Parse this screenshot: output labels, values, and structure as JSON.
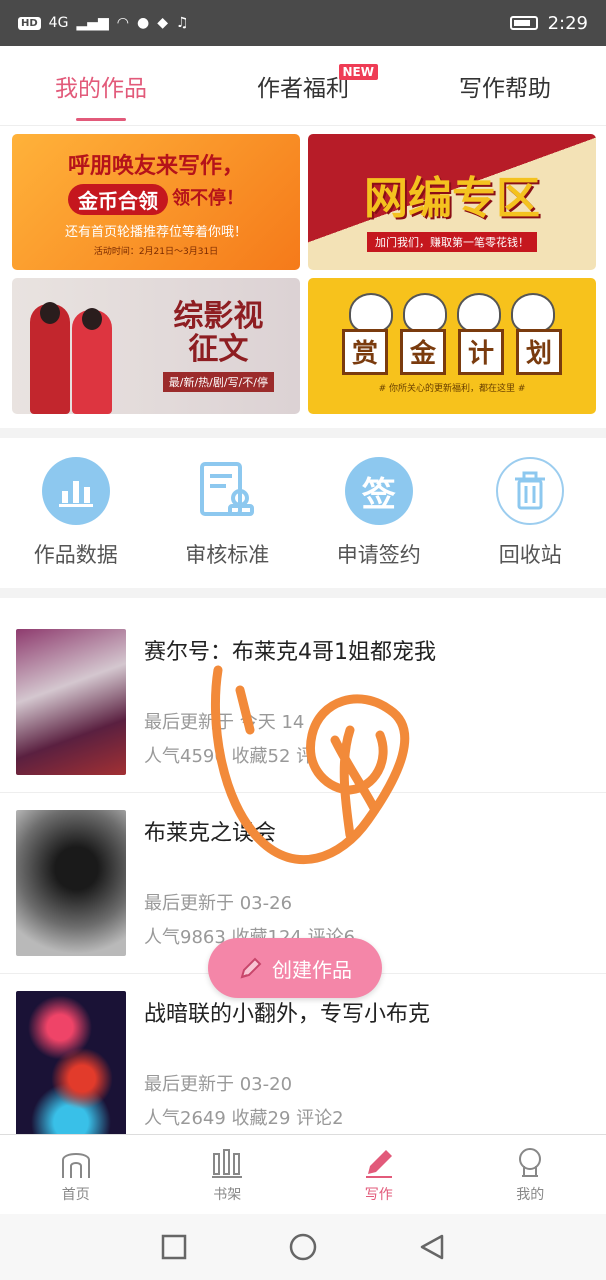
{
  "status_bar": {
    "chips": [
      "HD",
      "4G"
    ],
    "time": "2:29"
  },
  "tabs": [
    {
      "label": "我的作品"
    },
    {
      "label": "作者福利",
      "badge": "NEW"
    },
    {
      "label": "写作帮助"
    }
  ],
  "banners": {
    "b1": {
      "line1": "呼朋唤友来写作，",
      "line2": "金币合领",
      "line2b": "领不停！",
      "line3": "还有首页轮播推荐位等着你哦！",
      "line4": "活动时间：2月21日～3月31日"
    },
    "b2": {
      "title": "网编专区",
      "sub": "加门我们，赚取第一笔零花钱！"
    },
    "b3": {
      "title1": "综影视",
      "title2": "征文",
      "sub": "最/新/热/剧/写/不/停"
    },
    "b4": {
      "words": [
        "赏",
        "金",
        "计",
        "划"
      ],
      "sub": "# 你所关心的更新福利，都在这里 #"
    }
  },
  "shortcuts": [
    {
      "label": "作品数据",
      "icon": "bar-chart-icon"
    },
    {
      "label": "审核标准",
      "icon": "review-doc-icon"
    },
    {
      "label": "申请签约",
      "icon": "sign-icon",
      "glyph": "签"
    },
    {
      "label": "回收站",
      "icon": "trash-icon"
    }
  ],
  "works": [
    {
      "title": "赛尔号：布莱克4哥1姐都宠我",
      "updated": "最后更新于 今天 14",
      "stats": "人气4596 收藏52 评"
    },
    {
      "title": "布莱克之误会",
      "updated": "最后更新于 03-26",
      "stats": "人气9863 收藏124 评论6"
    },
    {
      "title": "战暗联的小翻外，专写小布克",
      "updated": "最后更新于 03-20",
      "stats": "人气2649 收藏29 评论2"
    }
  ],
  "fab": {
    "label": "创建作品"
  },
  "bottom_nav": [
    {
      "label": "首页",
      "icon": "home-icon"
    },
    {
      "label": "书架",
      "icon": "bookshelf-icon"
    },
    {
      "label": "写作",
      "icon": "pen-icon"
    },
    {
      "label": "我的",
      "icon": "profile-icon"
    }
  ],
  "colors": {
    "accent": "#e25a7a",
    "fab": "#f486a8",
    "status_bar": "#4a4a4a",
    "scribble": "#f28a3a"
  }
}
